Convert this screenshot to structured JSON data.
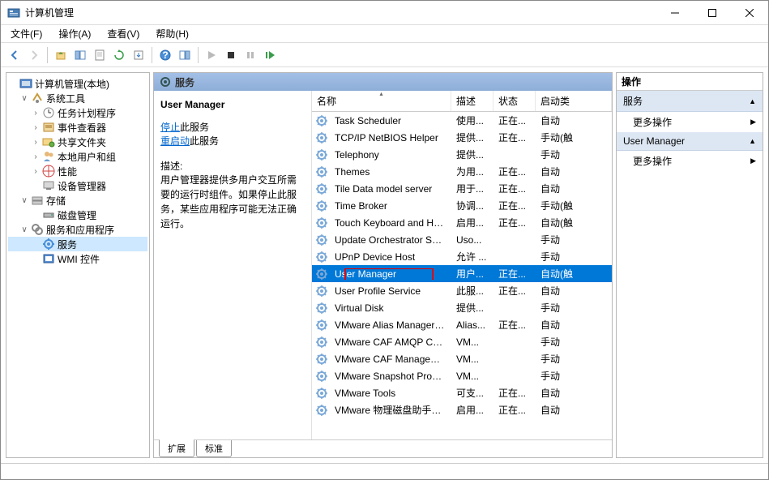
{
  "window": {
    "title": "计算机管理"
  },
  "menu": {
    "file": "文件(F)",
    "action": "操作(A)",
    "view": "查看(V)",
    "help": "帮助(H)"
  },
  "tree": {
    "root": "计算机管理(本地)",
    "system_tools": "系统工具",
    "task_scheduler": "任务计划程序",
    "event_viewer": "事件查看器",
    "shared_folders": "共享文件夹",
    "local_users": "本地用户和组",
    "performance": "性能",
    "device_manager": "设备管理器",
    "storage": "存储",
    "disk_management": "磁盘管理",
    "services_apps": "服务和应用程序",
    "services": "服务",
    "wmi": "WMI 控件"
  },
  "center": {
    "header": "服务",
    "service_name": "User Manager",
    "stop_link": "停止",
    "stop_suffix": "此服务",
    "restart_link": "重启动",
    "restart_suffix": "此服务",
    "desc_label": "描述:",
    "desc_text": "用户管理器提供多用户交互所需要的运行时组件。如果停止此服务，某些应用程序可能无法正确运行。",
    "columns": {
      "name": "名称",
      "desc": "描述",
      "status": "状态",
      "startup": "启动类"
    },
    "services": [
      {
        "name": "Task Scheduler",
        "desc": "使用...",
        "status": "正在...",
        "start": "自动"
      },
      {
        "name": "TCP/IP NetBIOS Helper",
        "desc": "提供...",
        "status": "正在...",
        "start": "手动(触"
      },
      {
        "name": "Telephony",
        "desc": "提供...",
        "status": "",
        "start": "手动"
      },
      {
        "name": "Themes",
        "desc": "为用...",
        "status": "正在...",
        "start": "自动"
      },
      {
        "name": "Tile Data model server",
        "desc": "用于...",
        "status": "正在...",
        "start": "自动"
      },
      {
        "name": "Time Broker",
        "desc": "协调...",
        "status": "正在...",
        "start": "手动(触"
      },
      {
        "name": "Touch Keyboard and Ha...",
        "desc": "启用...",
        "status": "正在...",
        "start": "自动(触"
      },
      {
        "name": "Update Orchestrator Ser...",
        "desc": "Uso...",
        "status": "",
        "start": "手动"
      },
      {
        "name": "UPnP Device Host",
        "desc": "允许 ...",
        "status": "",
        "start": "手动"
      },
      {
        "name": "User Manager",
        "desc": "用户...",
        "status": "正在...",
        "start": "自动(触",
        "selected": true
      },
      {
        "name": "User Profile Service",
        "desc": "此服...",
        "status": "正在...",
        "start": "自动"
      },
      {
        "name": "Virtual Disk",
        "desc": "提供...",
        "status": "",
        "start": "手动"
      },
      {
        "name": "VMware Alias Manager a...",
        "desc": "Alias...",
        "status": "正在...",
        "start": "自动"
      },
      {
        "name": "VMware CAF AMQP Com...",
        "desc": "VM...",
        "status": "",
        "start": "手动"
      },
      {
        "name": "VMware CAF Manageme...",
        "desc": "VM...",
        "status": "",
        "start": "手动"
      },
      {
        "name": "VMware Snapshot Provid...",
        "desc": "VM...",
        "status": "",
        "start": "手动"
      },
      {
        "name": "VMware Tools",
        "desc": "可支...",
        "status": "正在...",
        "start": "自动"
      },
      {
        "name": "VMware 物理磁盘助手服务",
        "desc": "启用...",
        "status": "正在...",
        "start": "自动"
      }
    ],
    "tabs": {
      "extended": "扩展",
      "standard": "标准"
    }
  },
  "actions": {
    "header": "操作",
    "group1": "服务",
    "more1": "更多操作",
    "group2": "User Manager",
    "more2": "更多操作"
  }
}
